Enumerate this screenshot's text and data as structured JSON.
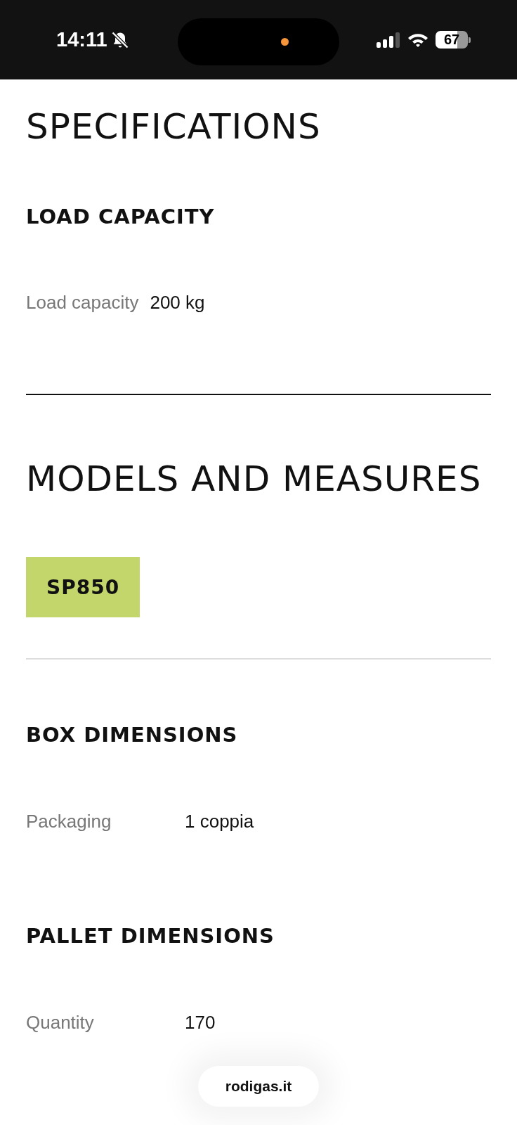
{
  "status_bar": {
    "time": "14:11",
    "battery": "67"
  },
  "title": "SPECIFICATIONS",
  "load_section": {
    "heading": "LOAD CAPACITY",
    "rows": [
      {
        "label": "Load capacity",
        "value": "200 kg"
      }
    ]
  },
  "models_title": "MODELS AND MEASURES",
  "models": [
    {
      "label": "SP850",
      "selected": true
    }
  ],
  "sections": [
    {
      "heading": "BOX DIMENSIONS",
      "rows": [
        {
          "label": "Packaging",
          "value": "1 coppia"
        }
      ]
    },
    {
      "heading": "PALLET DIMENSIONS",
      "rows": [
        {
          "label": "Quantity",
          "value": "170"
        }
      ]
    }
  ],
  "url_pill": "rodigas.it"
}
